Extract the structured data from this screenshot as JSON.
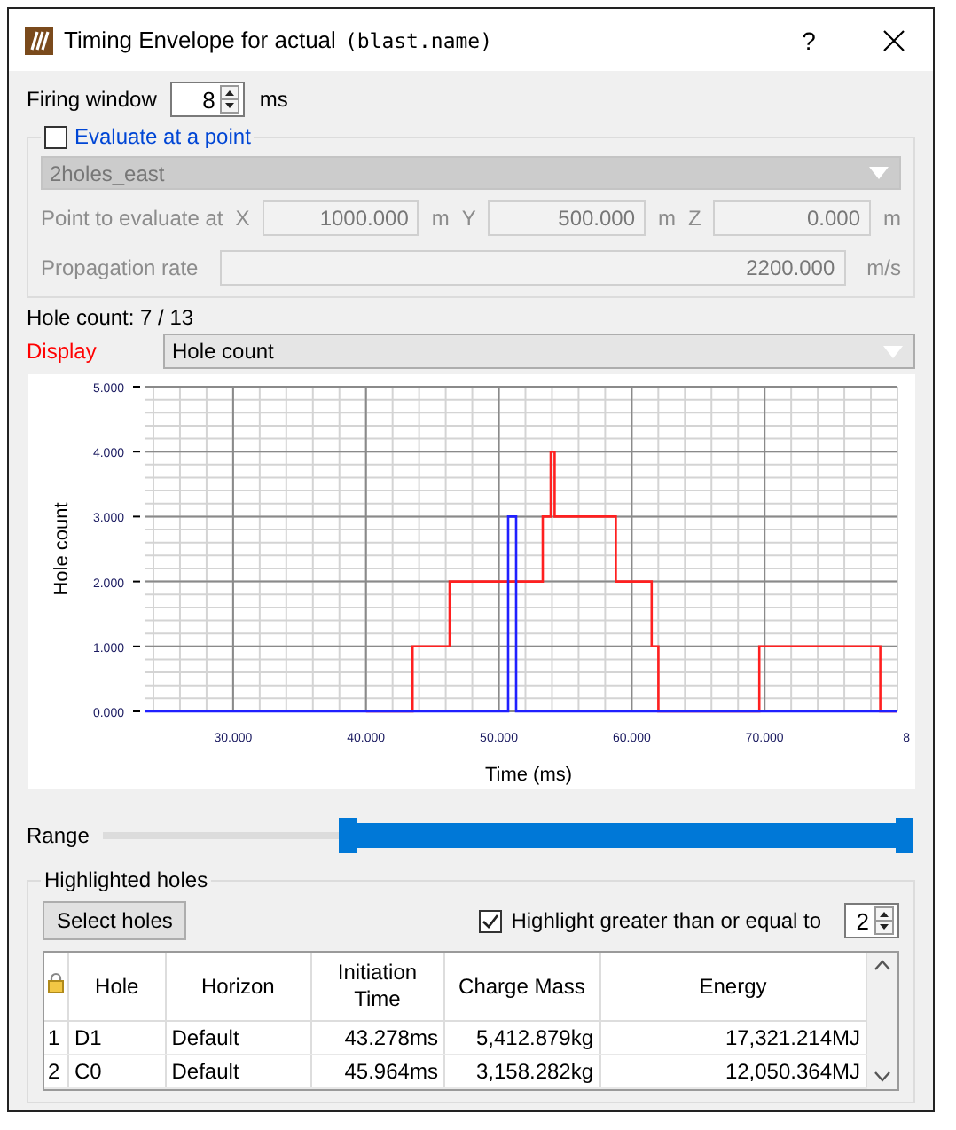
{
  "window": {
    "title": "Timing Envelope for actual",
    "subtitle": "(blast.name)",
    "help": "?"
  },
  "firing_window": {
    "label": "Firing window",
    "value": "8",
    "unit": "ms"
  },
  "evaluate_point": {
    "label": "Evaluate at a point",
    "checked": false,
    "disabled": true,
    "target": "2holes_east",
    "point_label": "Point to evaluate at",
    "coords": [
      {
        "axis": "X",
        "value": "1000.000",
        "unit": "m"
      },
      {
        "axis": "Y",
        "value": "500.000",
        "unit": "m"
      },
      {
        "axis": "Z",
        "value": "0.000",
        "unit": "m"
      }
    ],
    "propagation_label": "Propagation rate",
    "propagation_value": "2200.000",
    "propagation_unit": "m/s"
  },
  "hole_count": "Hole count: 7 / 13",
  "display": {
    "label": "Display",
    "value": "Hole count"
  },
  "chart": {
    "edge_tick_label": "8",
    "chart_data": {
      "type": "line",
      "xlabel": "Time (ms)",
      "ylabel": "Hole count",
      "x": [
        23.4,
        40,
        43.5,
        43.5,
        46.3,
        46.3,
        50.7,
        50.7,
        51.3,
        51.3,
        53.3,
        53.3,
        53.9,
        53.9,
        54.2,
        54.2,
        58.8,
        58.8,
        61.5,
        61.5,
        62,
        62,
        69.6,
        69.6,
        78.7,
        78.7,
        80
      ],
      "series": [
        {
          "color": "#ff2020",
          "values": [
            null,
            0,
            0,
            1,
            1,
            2,
            2,
            2,
            2,
            2,
            2,
            3,
            3,
            4,
            4,
            3,
            3,
            2,
            2,
            1,
            1,
            0,
            0,
            1,
            1,
            0,
            0
          ]
        },
        {
          "color": "#2020ff",
          "values": [
            0,
            0,
            0,
            0,
            0,
            0,
            0,
            3,
            3,
            0,
            0,
            0,
            0,
            0,
            0,
            0,
            0,
            0,
            0,
            0,
            0,
            0,
            0,
            0,
            0,
            0,
            0
          ]
        }
      ],
      "xlim": [
        23.4,
        80
      ],
      "ylim": [
        0,
        5
      ],
      "grid": true,
      "xticks": [
        {
          "value": 30,
          "label": "30.000"
        },
        {
          "value": 40,
          "label": "40.000"
        },
        {
          "value": 50,
          "label": "50.000"
        },
        {
          "value": 60,
          "label": "60.000"
        },
        {
          "value": 70,
          "label": "70.000"
        }
      ],
      "yticks": [
        {
          "value": 0,
          "label": "0.000"
        },
        {
          "value": 1,
          "label": "1.000"
        },
        {
          "value": 2,
          "label": "2.000"
        },
        {
          "value": 3,
          "label": "3.000"
        },
        {
          "value": 4,
          "label": "4.000"
        },
        {
          "value": 5,
          "label": "5.000"
        }
      ]
    }
  },
  "range": {
    "label": "Range",
    "level": 0.71
  },
  "highlighted": {
    "title": "Highlighted holes",
    "select_button": "Select holes",
    "highlight_label": "Highlight greater than or equal to",
    "highlight_checked": true,
    "threshold": "2"
  },
  "table": {
    "columns": [
      "Hole",
      "Horizon",
      "Initiation Time",
      "Charge Mass",
      "Energy"
    ],
    "rows": [
      {
        "number": "1",
        "cells": [
          "D1",
          "Default",
          "43.278ms",
          "5,412.879kg",
          "17,321.214MJ"
        ]
      },
      {
        "number": "2",
        "cells": [
          "C0",
          "Default",
          "45.964ms",
          "3,158.282kg",
          "12,050.364MJ"
        ]
      }
    ]
  }
}
